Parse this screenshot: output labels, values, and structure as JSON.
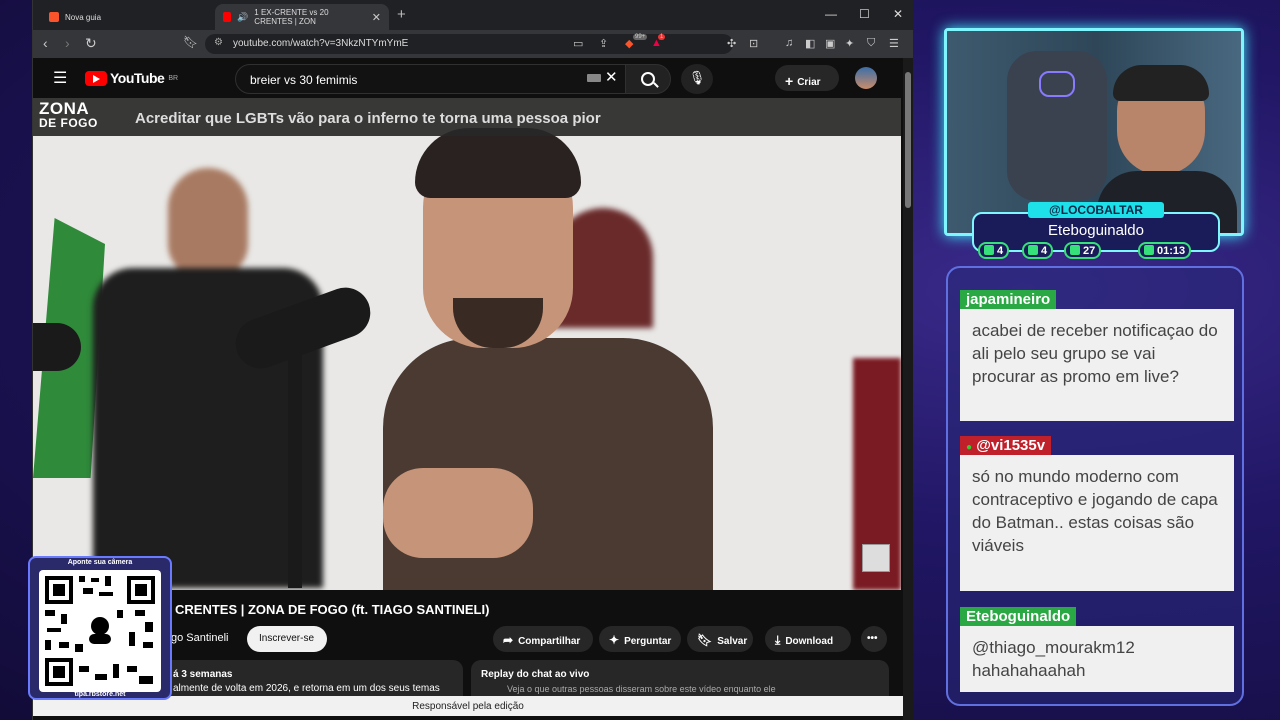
{
  "browser": {
    "tabs": [
      {
        "label": "Nova guia",
        "active": false
      },
      {
        "label": "1 EX-CRENTE vs 20 CRENTES | ZON",
        "active": true
      }
    ],
    "url": "youtube.com/watch?v=3NkzNTYmYmE",
    "badge_count": "99+",
    "alert_count": "1"
  },
  "youtube": {
    "logo_text": "YouTube",
    "region": "BR",
    "search_query": "breier vs 30 femimis",
    "create_label": "Criar",
    "player": {
      "banner_logo_line1": "ZONA",
      "banner_logo_line2": "DE FOGO",
      "banner_text": "Acreditar que LGBTs vão para o inferno te torna uma pessoa pior"
    },
    "video_title": "CRENTES | ZONA DE FOGO (ft. TIAGO SANTINELI)",
    "channel_name": "go Santineli",
    "subscribe_label": "Inscrever-se",
    "actions": {
      "share": "Compartilhar",
      "ask": "Perguntar",
      "save": "Salvar",
      "download": "Download",
      "more": "•••"
    },
    "description": {
      "date": "á 3 semanas",
      "text": "almente de volta em 2026, e retorna em um dos seus temas"
    },
    "chat_replay": {
      "title": "Replay do chat ao vivo",
      "subtitle": "Veja o que outras pessoas disseram sobre este vídeo enquanto ele"
    },
    "status_bar": "Responsável pela edição"
  },
  "overlay": {
    "qr_label": "Aponte sua câmera",
    "qr_url": "tipa.rbstore.net",
    "handle": "@LOCOBALTAR",
    "streamer": "Eteboguinaldo",
    "stats": [
      {
        "icon": "twitch-icon",
        "value": "4"
      },
      {
        "icon": "youtube-icon",
        "value": "4"
      },
      {
        "icon": "kick-icon",
        "value": "27"
      },
      {
        "icon": "clock-icon",
        "value": "01:13"
      }
    ],
    "chat": [
      {
        "user": "japamineiro",
        "user_color": "#2aa844",
        "text": "acabei de receber notificaçao do ali pelo seu grupo se vai procurar as promo em live?"
      },
      {
        "user": "@vi1535v",
        "user_color": "#c0202a",
        "text": "só no mundo moderno com contraceptivo e jogando de capa do Batman.. estas coisas são viáveis"
      },
      {
        "user": "Eteboguinaldo",
        "user_color": "#2aa844",
        "text": "@thiago_mourakm12 hahahahaahah"
      }
    ]
  }
}
